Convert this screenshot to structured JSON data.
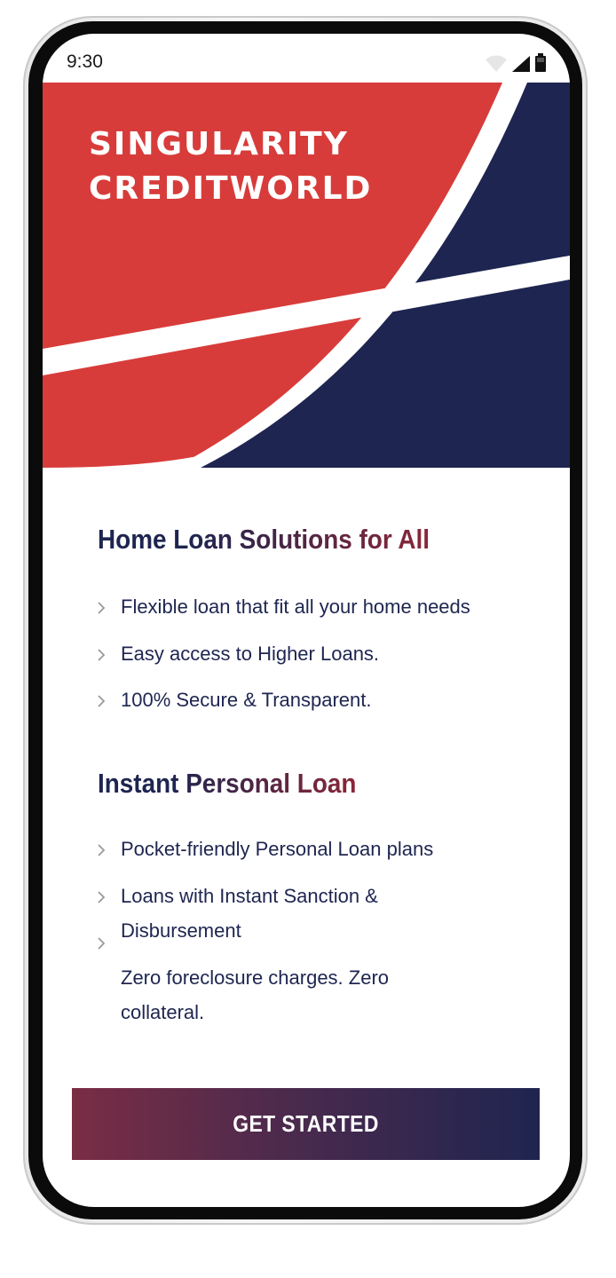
{
  "status_bar": {
    "time": "9:30",
    "icons": [
      "wifi-icon",
      "cellular-signal-icon",
      "battery-icon"
    ]
  },
  "hero": {
    "brand_line1": "SINGULARITY",
    "brand_line2": "CREDITWORLD",
    "colors": {
      "red": "#d73c3a",
      "navy": "#1e2550",
      "stripe": "#ffffff"
    }
  },
  "home_loan": {
    "title": "Home Loan Solutions for All",
    "bullets": [
      "Flexible loan that fit all your home needs",
      "Easy access to Higher Loans.",
      "100% Secure & Transparent."
    ]
  },
  "personal_loan": {
    "title": "Instant Personal Loan",
    "bullets": [
      "Pocket-friendly Personal Loan plans",
      "Loans with Instant Sanction & Disbursement",
      "Zero foreclosure charges. Zero collateral."
    ]
  },
  "cta": {
    "label": "GET STARTED",
    "gradient_from": "#7a2d44",
    "gradient_to": "#1e2550"
  }
}
